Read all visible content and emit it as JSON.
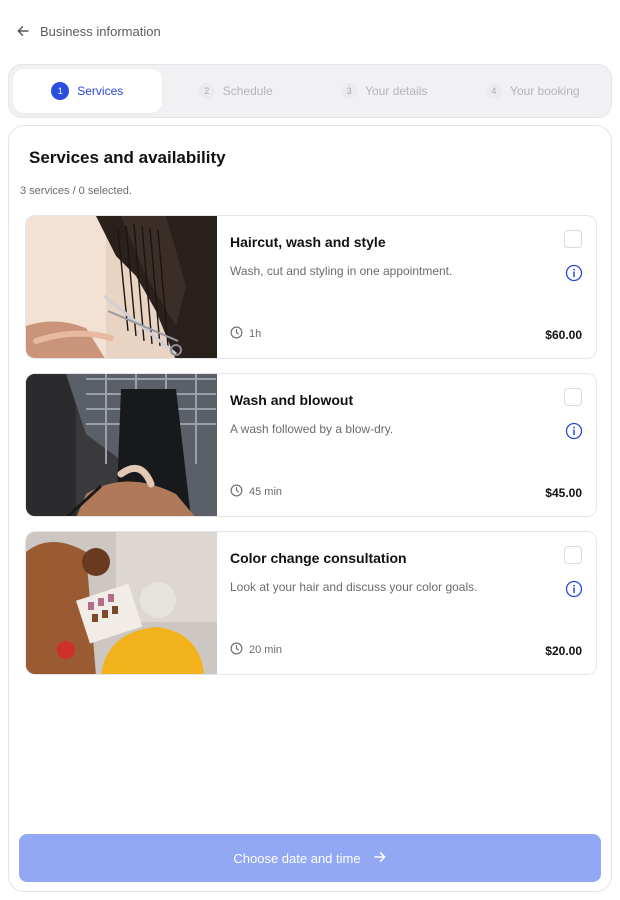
{
  "header": {
    "title": "Business information",
    "back_icon": "arrow-left-icon"
  },
  "steps": [
    {
      "num": "1",
      "label": "Services",
      "active": true
    },
    {
      "num": "2",
      "label": "Schedule",
      "active": false
    },
    {
      "num": "3",
      "label": "Your details",
      "active": false
    },
    {
      "num": "4",
      "label": "Your booking",
      "active": false
    }
  ],
  "main": {
    "title": "Services and availability",
    "count": "3 services / 0 selected.",
    "services": [
      {
        "name": "Haircut, wash and style",
        "description": "Wash, cut and styling in one appointment.",
        "duration": "1h",
        "price": "$60.00",
        "image": "haircut photo"
      },
      {
        "name": "Wash and blowout",
        "description": "A wash followed by a blow-dry.",
        "duration": "45 min",
        "price": "$45.00",
        "image": "wash photo"
      },
      {
        "name": "Color change consultation",
        "description": "Look at your hair and discuss your color goals.",
        "duration": "20 min",
        "price": "$20.00",
        "image": "color consultation photo"
      }
    ]
  },
  "cta": {
    "label": "Choose date and time",
    "icon": "arrow-right-icon"
  },
  "colors": {
    "accent": "#2a4fe0",
    "cta_disabled": "#93a8f4",
    "muted_text": "#6b6b6b"
  }
}
